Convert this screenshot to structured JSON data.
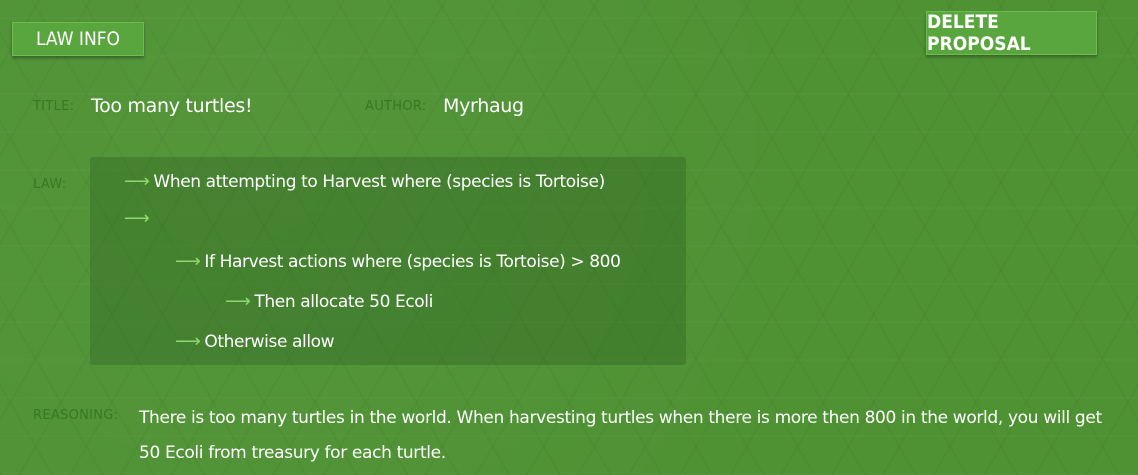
{
  "header": {
    "law_info_label": "LAW INFO",
    "delete_label": "DELETE PROPOSAL"
  },
  "fields": {
    "title_label": "TITLE:",
    "title_value": "Too many turtles!",
    "author_label": "AUTHOR:",
    "author_value": "Myrhaug",
    "law_label": "LAW:",
    "reasoning_label": "REASONING:",
    "reasoning_text": "There is too many turtles in the world. When harvesting turtles when there is more then 800 in the world, you will get 50 Ecoli from treasury for each turtle."
  },
  "law": {
    "arrow_icon": "right-arrow-icon",
    "lines": [
      {
        "text": "When attempting to Harvest where (species is Tortoise)",
        "indent": 0
      },
      {
        "text": "",
        "indent": 0
      },
      {
        "text": "If Harvest actions where (species is Tortoise) > 800",
        "indent": 1
      },
      {
        "text": "Then allocate 50 Ecoli",
        "indent": 2
      },
      {
        "text": "Otherwise allow",
        "indent": 1
      }
    ]
  },
  "colors": {
    "background": "#4f9234",
    "button": "#59a53e",
    "label": "#357a22",
    "arrow": "#8fd86f"
  }
}
